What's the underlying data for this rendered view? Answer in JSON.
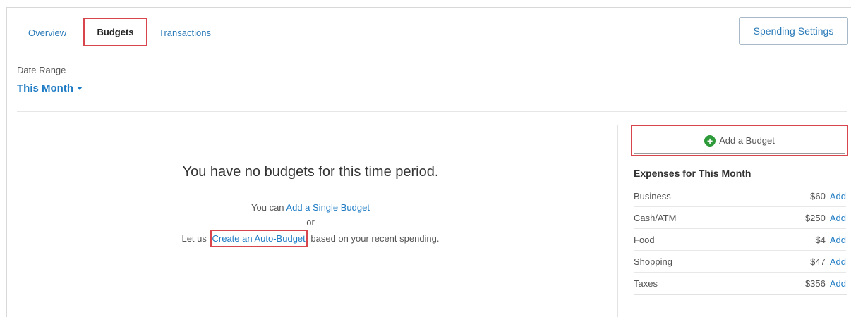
{
  "tabs": {
    "overview": "Overview",
    "budgets": "Budgets",
    "transactions": "Transactions"
  },
  "spending_settings_label": "Spending Settings",
  "date_range": {
    "label": "Date Range",
    "value": "This Month"
  },
  "empty_state": {
    "title": "You have no budgets for this time period.",
    "line1_prefix": "You can ",
    "line1_link": "Add a Single Budget",
    "line2": "or",
    "line3_prefix": "Let us ",
    "line3_link": "Create an Auto-Budget",
    "line3_suffix": " based on your recent spending."
  },
  "add_budget_label": "Add a Budget",
  "expenses": {
    "title": "Expenses for This Month",
    "add_label": "Add",
    "rows": [
      {
        "category": "Business",
        "amount": "$60"
      },
      {
        "category": "Cash/ATM",
        "amount": "$250"
      },
      {
        "category": "Food",
        "amount": "$4"
      },
      {
        "category": "Shopping",
        "amount": "$47"
      },
      {
        "category": "Taxes",
        "amount": "$356"
      }
    ]
  },
  "colors": {
    "link": "#1f7cc4",
    "highlight": "#d9454d",
    "plus": "#2e9b3a"
  },
  "icons": {
    "add_budget": "plus-circle-icon",
    "date_range": "caret-down-icon"
  }
}
